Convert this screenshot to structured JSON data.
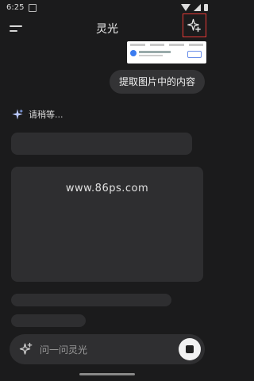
{
  "status_bar": {
    "time": "6:25"
  },
  "header": {
    "title": "灵光",
    "menu_icon": "menu-icon",
    "new_chat_icon": "sparkle-plus-icon"
  },
  "message": {
    "user_text": "提取图片中的内容"
  },
  "assistant": {
    "status_icon": "sparkle-icon",
    "status_text": "请稍等..."
  },
  "watermark": "www.86ps.com",
  "composer": {
    "placeholder": "问一问灵光",
    "left_icon": "sparkle-add-icon",
    "action_icon": "stop-icon"
  },
  "colors": {
    "background": "#1b1b1c",
    "bubble": "#333335",
    "highlight_border": "#e53935",
    "skeleton": "#2e2e30"
  }
}
